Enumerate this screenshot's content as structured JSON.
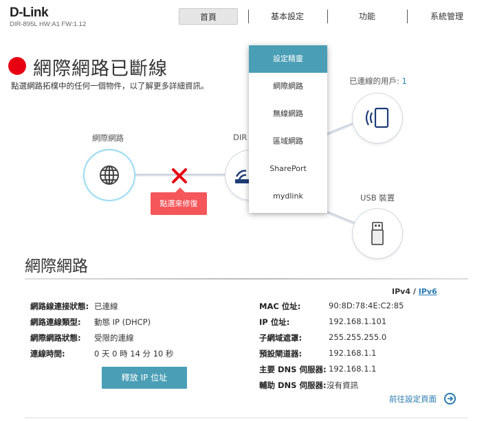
{
  "header": {
    "logo": "D-Link",
    "model": "DIR-895L HW:A1 FW:1.12",
    "tabs": [
      "首頁",
      "基本設定",
      "功能",
      "系統管理"
    ]
  },
  "status": {
    "title": "網際網路已斷線",
    "subtitle": "點選網路拓樸中的任何一個物件，以了解更多詳細資訊。"
  },
  "topology": {
    "internet_label": "網際網路",
    "router_label": "DIR",
    "clients_label": "已連線的用戶:",
    "clients_count": "1",
    "usb_label": "USB 裝置",
    "repair_label": "點選來修復"
  },
  "dropdown": {
    "items": [
      "設定精靈",
      "網際網路",
      "無線網路",
      "區域網路",
      "SharePort",
      "mydlink"
    ]
  },
  "section": {
    "title": "網際網路",
    "ipv4": "IPv4",
    "ipv_sep": "/",
    "ipv6": "IPv6"
  },
  "left_info": [
    {
      "label": "網路線連接狀態:",
      "value": "已連線"
    },
    {
      "label": "網路連線類型:",
      "value": "動態 IP (DHCP)"
    },
    {
      "label": "網際網路狀態:",
      "value": "受限的連線"
    },
    {
      "label": "連線時間:",
      "value": "0 天 0 時 14 分 10 秒"
    }
  ],
  "right_info": [
    {
      "label": "MAC 位址:",
      "value": "90:8D:78:4E:C2:85"
    },
    {
      "label": "IP 位址:",
      "value": "192.168.1.101"
    },
    {
      "label": "子網域遮罩:",
      "value": "255.255.255.0"
    },
    {
      "label": "預設閘道器:",
      "value": "192.168.1.1"
    },
    {
      "label": "主要 DNS 伺服器:",
      "value": "192.168.1.1"
    },
    {
      "label": "輔助 DNS 伺服器:",
      "value": "沒有資訊"
    }
  ],
  "buttons": {
    "release": "釋放 IP 位址",
    "goto_settings": "前往設定頁面"
  },
  "colors": {
    "status": "#e60012",
    "accent": "#4a9eb5",
    "link": "#2a7ab0",
    "repair": "#f5565a"
  }
}
